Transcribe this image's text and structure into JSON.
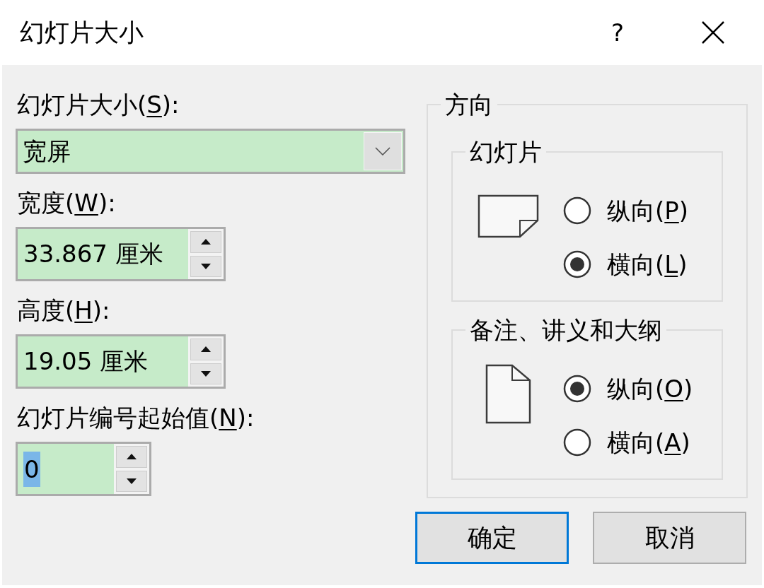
{
  "window": {
    "title": "幻灯片大小",
    "help_button": "?"
  },
  "slide_size": {
    "label_before": "幻灯片大小(",
    "access_key": "S",
    "label_after": "):",
    "value": "宽屏"
  },
  "width": {
    "label_before": "宽度(",
    "access_key": "W",
    "label_after": "):",
    "value": "33.867 厘米"
  },
  "height": {
    "label_before": "高度(",
    "access_key": "H",
    "label_after": "):",
    "value": "19.05 厘米"
  },
  "start_number": {
    "label_before": "幻灯片编号起始值(",
    "access_key": "N",
    "label_after": "):",
    "value": "0",
    "value_selected": true
  },
  "orientation": {
    "title": "方向",
    "groups": [
      {
        "title": "幻灯片",
        "options": [
          {
            "label_before": "纵向(",
            "access_key": "P",
            "label_after": ")",
            "selected": false
          },
          {
            "label_before": "横向(",
            "access_key": "L",
            "label_after": ")",
            "selected": true
          }
        ]
      },
      {
        "title": "备注、讲义和大纲",
        "options": [
          {
            "label_before": "纵向(",
            "access_key": "O",
            "label_after": ")",
            "selected": true
          },
          {
            "label_before": "横向(",
            "access_key": "A",
            "label_after": ")",
            "selected": false
          }
        ]
      }
    ]
  },
  "buttons": [
    {
      "label": "确定",
      "default": true
    },
    {
      "label": "取消",
      "default": false
    }
  ]
}
